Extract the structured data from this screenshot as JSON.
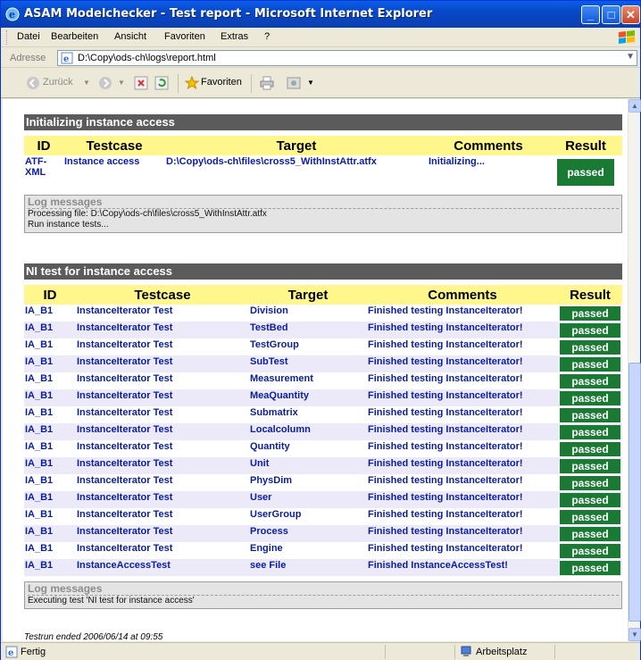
{
  "window": {
    "title": "ASAM Modelchecker - Test report - Microsoft Internet Explorer",
    "buttons": [
      "minimize",
      "maximize",
      "close"
    ]
  },
  "menu": [
    "Datei",
    "Bearbeiten",
    "Ansicht",
    "Favoriten",
    "Extras",
    "?"
  ],
  "address": {
    "label": "Adresse",
    "url": "D:\\Copy\\ods-ch\\logs\\report.html"
  },
  "toolbar": {
    "back": "Zurück",
    "favorites": "Favoriten"
  },
  "section1": {
    "title": "Initializing instance access",
    "headers": [
      "ID",
      "Testcase",
      "Target",
      "Comments",
      "Result"
    ],
    "rows": [
      [
        "ATF-XML",
        "Instance access",
        "D:\\Copy\\ods-ch\\files\\cross5_WithInstAttr.atfx",
        "Initializing...",
        "passed"
      ]
    ],
    "log_title": "Log messages",
    "log": [
      "Processing file: D:\\Copy\\ods-ch\\files\\cross5_WithInstAttr.atfx",
      "Run instance tests..."
    ]
  },
  "section2": {
    "title": "NI test for instance access",
    "headers": [
      "ID",
      "Testcase",
      "Target",
      "Comments",
      "Result"
    ],
    "rows": [
      [
        "IA_B1",
        "InstanceIterator Test",
        "Division",
        "Finished testing InstanceIterator!",
        "passed"
      ],
      [
        "IA_B1",
        "InstanceIterator Test",
        "TestBed",
        "Finished testing InstanceIterator!",
        "passed"
      ],
      [
        "IA_B1",
        "InstanceIterator Test",
        "TestGroup",
        "Finished testing InstanceIterator!",
        "passed"
      ],
      [
        "IA_B1",
        "InstanceIterator Test",
        "SubTest",
        "Finished testing InstanceIterator!",
        "passed"
      ],
      [
        "IA_B1",
        "InstanceIterator Test",
        "Measurement",
        "Finished testing InstanceIterator!",
        "passed"
      ],
      [
        "IA_B1",
        "InstanceIterator Test",
        "MeaQuantity",
        "Finished testing InstanceIterator!",
        "passed"
      ],
      [
        "IA_B1",
        "InstanceIterator Test",
        "Submatrix",
        "Finished testing InstanceIterator!",
        "passed"
      ],
      [
        "IA_B1",
        "InstanceIterator Test",
        "Localcolumn",
        "Finished testing InstanceIterator!",
        "passed"
      ],
      [
        "IA_B1",
        "InstanceIterator Test",
        "Quantity",
        "Finished testing InstanceIterator!",
        "passed"
      ],
      [
        "IA_B1",
        "InstanceIterator Test",
        "Unit",
        "Finished testing InstanceIterator!",
        "passed"
      ],
      [
        "IA_B1",
        "InstanceIterator Test",
        "PhysDim",
        "Finished testing InstanceIterator!",
        "passed"
      ],
      [
        "IA_B1",
        "InstanceIterator Test",
        "User",
        "Finished testing InstanceIterator!",
        "passed"
      ],
      [
        "IA_B1",
        "InstanceIterator Test",
        "UserGroup",
        "Finished testing InstanceIterator!",
        "passed"
      ],
      [
        "IA_B1",
        "InstanceIterator Test",
        "Process",
        "Finished testing InstanceIterator!",
        "passed"
      ],
      [
        "IA_B1",
        "InstanceIterator Test",
        "Engine",
        "Finished testing InstanceIterator!",
        "passed"
      ],
      [
        "IA_B1",
        "InstanceAccessTest",
        "see File",
        "Finished InstanceAccessTest!",
        "passed"
      ]
    ],
    "log_title": "Log messages",
    "log": [
      "Executing test 'NI test for instance access'"
    ]
  },
  "footer": "Testrun ended 2006/06/14 at 09:55",
  "status": {
    "text": "Fertig",
    "zone": "Arbeitsplatz"
  },
  "colors": {
    "passed": "#1a7a34",
    "header_bg": "#fff68c",
    "section_bar": "#5b5b5b",
    "link_text": "#0b1da0"
  }
}
